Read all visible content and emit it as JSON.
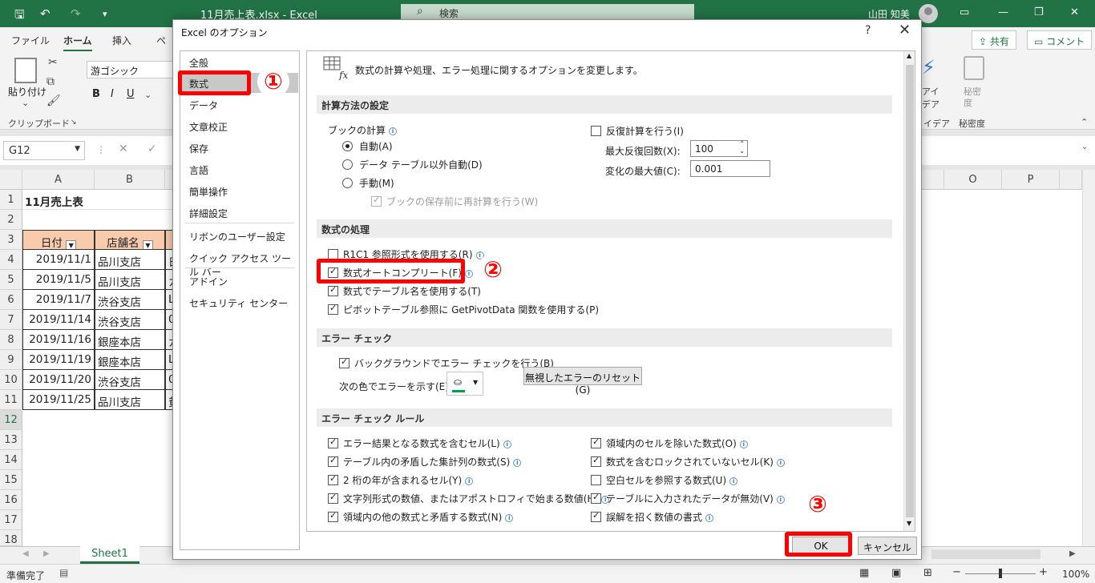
{
  "titlebar": {
    "title": "11月売上表.xlsx  -  Excel",
    "search_placeholder": "検索",
    "user": "山田 知美"
  },
  "ribbon": {
    "tabs": [
      "ファイル",
      "ホーム",
      "挿入",
      "ペ"
    ],
    "share": "共有",
    "comment": "コメント",
    "paste": "貼り付け",
    "font_name": "游ゴシック",
    "clipboard": "クリップボード",
    "ideas_a": "アイ",
    "ideas_b": "デア",
    "ideas_group": "イデア",
    "sensitivity_a": "秘密",
    "sensitivity_b": "度",
    "sensitivity_group": "秘密度"
  },
  "formula_bar": {
    "name_box": "G12"
  },
  "sheet": {
    "columns": [
      "A",
      "B",
      "O",
      "P"
    ],
    "rows": [
      "1",
      "2",
      "3",
      "4",
      "5",
      "6",
      "7",
      "8",
      "9",
      "10",
      "11",
      "12",
      "13",
      "14",
      "15",
      "16",
      "17",
      "18"
    ],
    "title": "11月売上表",
    "header": [
      "日付",
      "店舗名"
    ],
    "data": [
      [
        "2019/11/1",
        "品川支店",
        "日"
      ],
      [
        "2019/11/5",
        "品川支店",
        "カ"
      ],
      [
        "2019/11/7",
        "渋谷支店",
        "L"
      ],
      [
        "2019/11/14",
        "渋谷支店",
        "0"
      ],
      [
        "2019/11/16",
        "銀座本店",
        "ガ"
      ],
      [
        "2019/11/19",
        "銀座本店",
        "L"
      ],
      [
        "2019/11/20",
        "渋谷支店",
        "0"
      ],
      [
        "2019/11/25",
        "品川支店",
        "貧"
      ]
    ],
    "tab": "Sheet1",
    "status": "準備完了",
    "zoom": "100%"
  },
  "dialog": {
    "title": "Excel のオプション",
    "help": "?",
    "close": "✕",
    "nav": [
      "全般",
      "数式",
      "データ",
      "文章校正",
      "保存",
      "言語",
      "簡単操作",
      "詳細設定",
      "リボンのユーザー設定",
      "クイック アクセス ツール バー",
      "アドイン",
      "セキュリティ センター"
    ],
    "header_text": "数式の計算や処理、エラー処理に関するオプションを変更します。",
    "sec_calc": "計算方法の設定",
    "book_calc": "ブックの計算",
    "calc_auto": "自動(A)",
    "calc_auto_except": "データ テーブル以外自動(D)",
    "calc_manual": "手動(M)",
    "recalc_before_save": "ブックの保存前に再計算を行う(W)",
    "iterative": "反復計算を行う(I)",
    "max_iter_label": "最大反復回数(X):",
    "max_iter_value": "100",
    "max_change_label": "変化の最大値(C):",
    "max_change_value": "0.001",
    "sec_formulas": "数式の処理",
    "r1c1": "R1C1 参照形式を使用する(R)",
    "autocomplete": "数式オートコンプリート(F)",
    "table_names": "数式でテーブル名を使用する(T)",
    "getpivotdata": "ピボットテーブル参照に GetPivotData 関数を使用する(P)",
    "sec_error": "エラー チェック",
    "bg_error": "バックグラウンドでエラー チェックを行う(B)",
    "error_color_label": "次の色でエラーを示す(E):",
    "reset_ignored": "無視したエラーのリセット(G)",
    "sec_rules": "エラー チェック ルール",
    "rules_left": [
      {
        "label": "エラー結果となる数式を含むセル(L)",
        "checked": true
      },
      {
        "label": "テーブル内の矛盾した集計列の数式(S)",
        "checked": true
      },
      {
        "label": "2 桁の年が含まれるセル(Y)",
        "checked": true
      },
      {
        "label": "文字列形式の数値、またはアポストロフィで始まる数値(H)",
        "checked": true
      },
      {
        "label": "領域内の他の数式と矛盾する数式(N)",
        "checked": true
      }
    ],
    "rules_right": [
      {
        "label": "領域内のセルを除いた数式(O)",
        "checked": true
      },
      {
        "label": "数式を含むロックされていないセル(K)",
        "checked": true
      },
      {
        "label": "空白セルを参照する数式(U)",
        "checked": false
      },
      {
        "label": "テーブルに入力されたデータが無効(V)",
        "checked": true
      },
      {
        "label": "誤解を招く数値の書式",
        "checked": true
      }
    ],
    "ok": "OK",
    "cancel": "キャンセル"
  },
  "annotations": {
    "step1": "①",
    "step2": "②",
    "step3": "③",
    "highlight_color": "#ff0000"
  }
}
